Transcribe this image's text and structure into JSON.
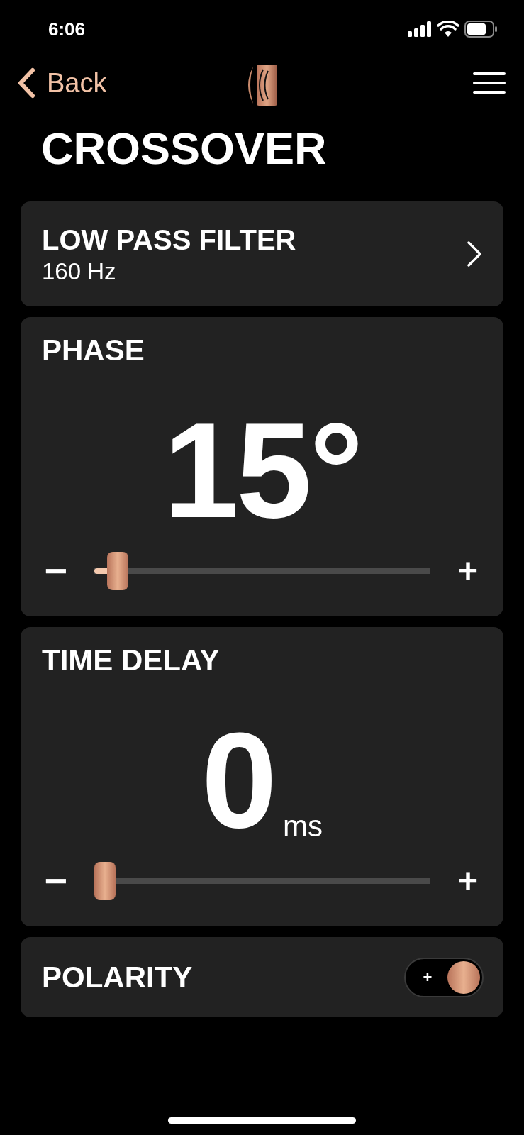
{
  "status_bar": {
    "time": "6:06"
  },
  "nav": {
    "back": "Back"
  },
  "title": "CROSSOVER",
  "filter": {
    "label": "LOW PASS FILTER",
    "value": "160 Hz"
  },
  "controls": [
    {
      "label": "PHASE",
      "value": "15°",
      "level": 0.07,
      "minus": "−",
      "plus": "+"
    },
    {
      "label": "TIME DELAY",
      "value": "0",
      "unit": "ms",
      "level": 0.0,
      "minus": "−",
      "plus": "+"
    }
  ],
  "polarity": {
    "label": "POLARITY",
    "sign": "+",
    "on": true
  }
}
